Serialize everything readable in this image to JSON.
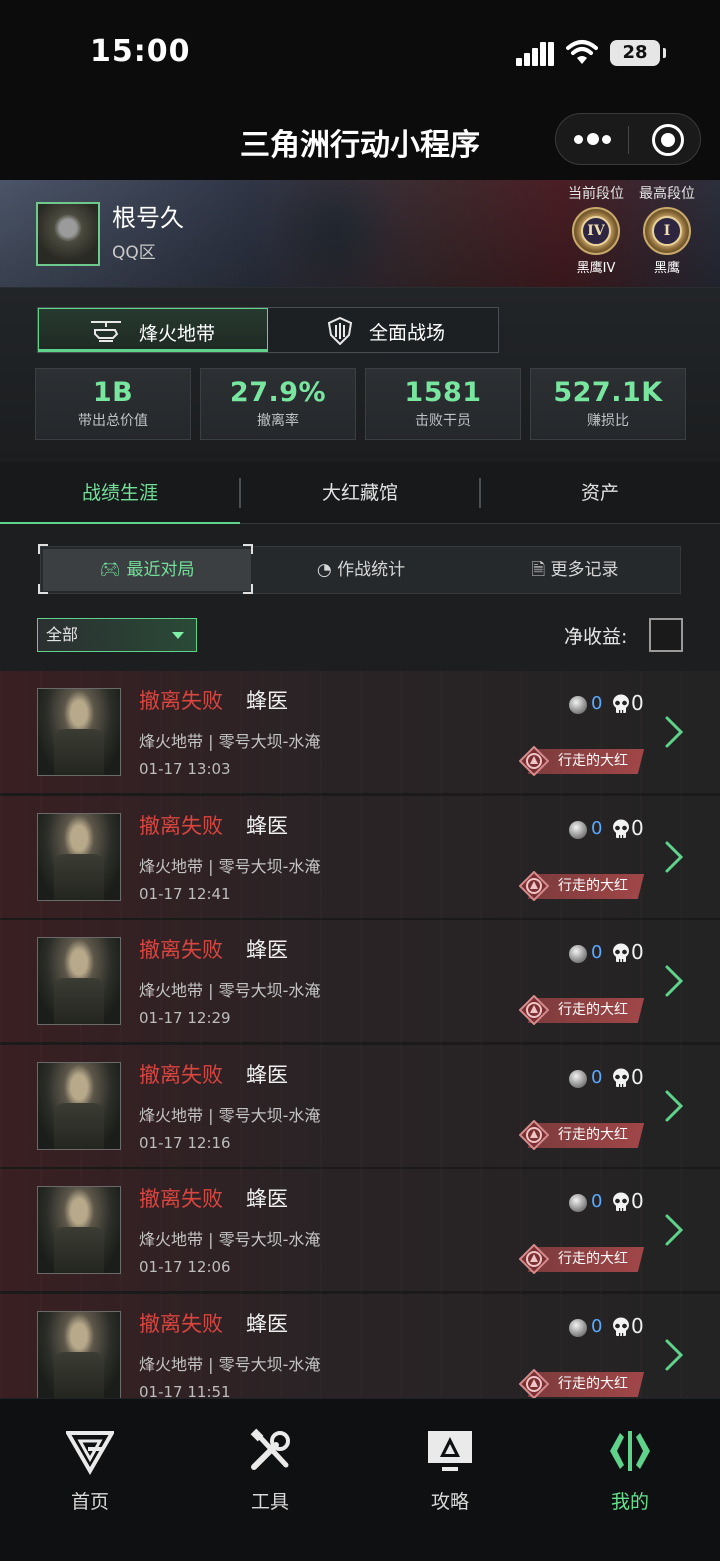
{
  "status": {
    "time": "15:00",
    "battery": "28"
  },
  "nav": {
    "title": "三角洲行动小程序"
  },
  "profile": {
    "name": "根号久",
    "region": "QQ区",
    "current_rank_label": "当前段位",
    "current_rank_numeral": "IV",
    "current_rank_name": "黑鹰IV",
    "highest_rank_label": "最高段位",
    "highest_rank_numeral": "I",
    "highest_rank_name": "黑鹰"
  },
  "modes": [
    {
      "label": "烽火地带",
      "active": true
    },
    {
      "label": "全面战场",
      "active": false
    }
  ],
  "stats": [
    {
      "value": "1B",
      "label": "带出总价值"
    },
    {
      "value": "27.9%",
      "label": "撤离率"
    },
    {
      "value": "1581",
      "label": "击败干员"
    },
    {
      "value": "527.1K",
      "label": "赚损比"
    }
  ],
  "sections": [
    {
      "label": "战绩生涯",
      "active": true
    },
    {
      "label": "大红藏馆"
    },
    {
      "label": "资产"
    }
  ],
  "subtabs": [
    {
      "label": "最近对局",
      "active": true
    },
    {
      "label": "作战统计"
    },
    {
      "label": "更多记录"
    }
  ],
  "filter": {
    "selected": "全部",
    "net_label": "净收益:"
  },
  "matches": [
    {
      "result": "撤离失败",
      "operator": "蜂医",
      "map": "烽火地带 | 零号大坝-水淹",
      "time": "01-17 13:03",
      "value": "0",
      "kills": "0",
      "badge": "行走的大红"
    },
    {
      "result": "撤离失败",
      "operator": "蜂医",
      "map": "烽火地带 | 零号大坝-水淹",
      "time": "01-17 12:41",
      "value": "0",
      "kills": "0",
      "badge": "行走的大红"
    },
    {
      "result": "撤离失败",
      "operator": "蜂医",
      "map": "烽火地带 | 零号大坝-水淹",
      "time": "01-17 12:29",
      "value": "0",
      "kills": "0",
      "badge": "行走的大红"
    },
    {
      "result": "撤离失败",
      "operator": "蜂医",
      "map": "烽火地带 | 零号大坝-水淹",
      "time": "01-17 12:16",
      "value": "0",
      "kills": "0",
      "badge": "行走的大红"
    },
    {
      "result": "撤离失败",
      "operator": "蜂医",
      "map": "烽火地带 | 零号大坝-水淹",
      "time": "01-17 12:06",
      "value": "0",
      "kills": "0",
      "badge": "行走的大红"
    },
    {
      "result": "撤离失败",
      "operator": "蜂医",
      "map": "烽火地带 | 零号大坝-水淹",
      "time": "01-17 11:51",
      "value": "0",
      "kills": "0",
      "badge": "行走的大红"
    }
  ],
  "tabbar": [
    {
      "label": "首页",
      "icon": "home-logo-icon"
    },
    {
      "label": "工具",
      "icon": "tools-icon"
    },
    {
      "label": "攻略",
      "icon": "guide-monitor-icon"
    },
    {
      "label": "我的",
      "icon": "profile-emblem-icon",
      "active": true
    }
  ],
  "colors": {
    "accent": "#5fd38b",
    "fail": "#d9453f",
    "coin_value": "#5aa9ff",
    "badge": "#a04648"
  }
}
